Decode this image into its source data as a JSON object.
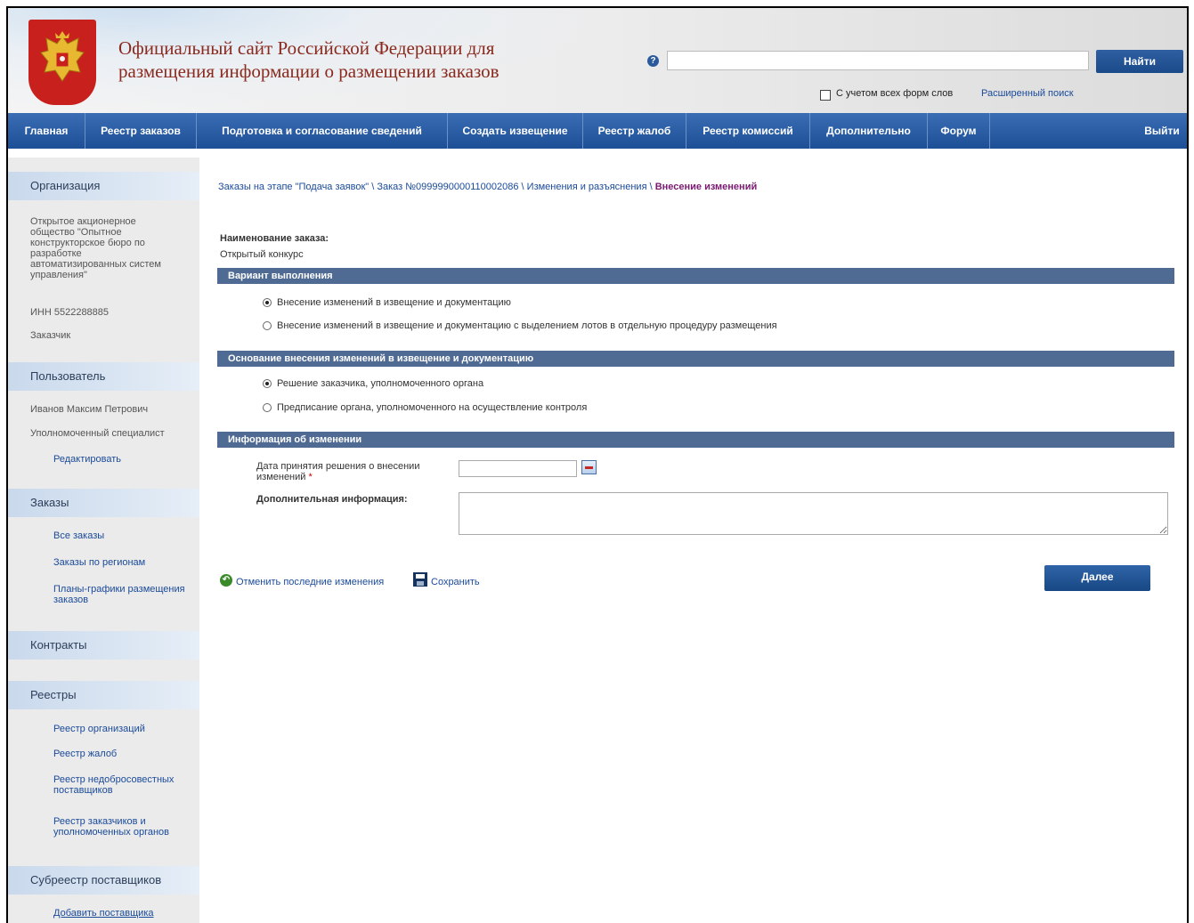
{
  "header": {
    "title_line1": "Официальный сайт Российской Федерации для",
    "title_line2": "размещения информации о размещении заказов",
    "help_icon_glyph": "?",
    "search_value": "",
    "search_button": "Найти",
    "morphology_checkbox_label": "С учетом всех форм слов",
    "advanced_search_link": "Расширенный поиск"
  },
  "nav": {
    "items": [
      {
        "label": "Главная"
      },
      {
        "label": "Реестр заказов"
      },
      {
        "label": "Подготовка и согласование сведений"
      },
      {
        "label": "Создать извещение"
      },
      {
        "label": "Реестр жалоб"
      },
      {
        "label": "Реестр комиссий"
      },
      {
        "label": "Дополнительно"
      },
      {
        "label": "Форум"
      }
    ],
    "logout": "Выйти"
  },
  "sidebar": {
    "organization": {
      "heading": "Организация",
      "name_lines": [
        "Открытое акционерное",
        "общество \"Опытное",
        "конструкторское бюро по",
        "разработке",
        "автоматизированных систем",
        "управления\""
      ],
      "inn": "ИНН 5522288885",
      "role": "Заказчик"
    },
    "user": {
      "heading": "Пользователь",
      "name": "Иванов Максим Петрович",
      "role": "Уполномоченный специалист",
      "edit_link": "Редактировать"
    },
    "orders": {
      "heading": "Заказы",
      "links": [
        "Все заказы",
        "Заказы по регионам",
        "Планы-графики размещения",
        "заказов"
      ]
    },
    "contracts": {
      "heading": "Контракты"
    },
    "registries": {
      "heading": "Реестры",
      "links": [
        "Реестр организаций",
        "Реестр жалоб",
        "Реестр недобросовестных",
        "поставщиков",
        "Реестр заказчиков и",
        "уполномоченных органов"
      ]
    },
    "subregistry": {
      "heading": "Субреестр поставщиков",
      "add_link": "Добавить поставщика"
    }
  },
  "breadcrumb": {
    "part1": "Заказы на этапе \"Подача заявок\"",
    "part2": "Заказ №0999990000110002086",
    "part3": "Изменения и разъяснения",
    "separator": " \\ ",
    "current": "Внесение изменений"
  },
  "order": {
    "name_label": "Наименование заказа:",
    "name_value": "Открытый конкурс"
  },
  "sections": {
    "variant": {
      "title": "Вариант выполнения",
      "options": [
        {
          "label": "Внесение изменений в извещение и документацию",
          "selected": true
        },
        {
          "label": "Внесение изменений в извещение и документацию с выделением лотов в отдельную процедуру размещения",
          "selected": false
        }
      ]
    },
    "basis": {
      "title": "Основание внесения изменений в извещение и документацию",
      "options": [
        {
          "label": "Решение заказчика, уполномоченного органа",
          "selected": true
        },
        {
          "label": "Предписание органа, уполномоченного на осуществление контроля",
          "selected": false
        }
      ]
    },
    "info": {
      "title": "Информация об изменении",
      "date_label_line1": "Дата принятия решения о внесении",
      "date_label_line2": "изменений",
      "required_mark": "*",
      "date_value": "",
      "additional_label": "Дополнительная информация:",
      "additional_value": ""
    }
  },
  "actions": {
    "undo_label": "Отменить последние изменения",
    "save_label": "Сохранить",
    "next_label": "Далее"
  },
  "colors": {
    "nav_blue": "#1c4f96",
    "section_bar": "#506b93",
    "link": "#1a4a9a",
    "breadcrumb_current": "#7a1b72",
    "title_brown": "#8a2a1f"
  }
}
